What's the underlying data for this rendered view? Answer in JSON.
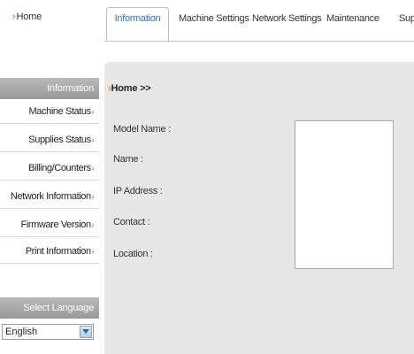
{
  "header": {
    "home_label": "Home",
    "tabs": [
      {
        "label": "Information",
        "active": true
      },
      {
        "label": "Machine Settings",
        "active": false
      },
      {
        "label": "Network Settings",
        "active": false
      },
      {
        "label": "Maintenance",
        "active": false
      },
      {
        "label": "Supp",
        "active": false
      }
    ]
  },
  "sidebar": {
    "section_title": "Information",
    "items": [
      {
        "label": "Machine Status"
      },
      {
        "label": "Supplies Status"
      },
      {
        "label": "Billing/Counters"
      },
      {
        "label": "Network Information"
      },
      {
        "label": "Firmware Version"
      },
      {
        "label": "Print Information"
      }
    ],
    "language_title": "Select Language",
    "language_value": "English"
  },
  "main": {
    "breadcrumb": "Home >>",
    "fields": [
      {
        "label": "Model Name :"
      },
      {
        "label": "Name :"
      },
      {
        "label": "IP Address :"
      },
      {
        "label": "Contact :"
      },
      {
        "label": "Location :"
      }
    ]
  },
  "colors": {
    "accent_orange": "#f08a00",
    "active_tab_text": "#2c74c4",
    "panel_bg": "#e7e7e7",
    "sidebar_header": "#a8a8a8"
  }
}
